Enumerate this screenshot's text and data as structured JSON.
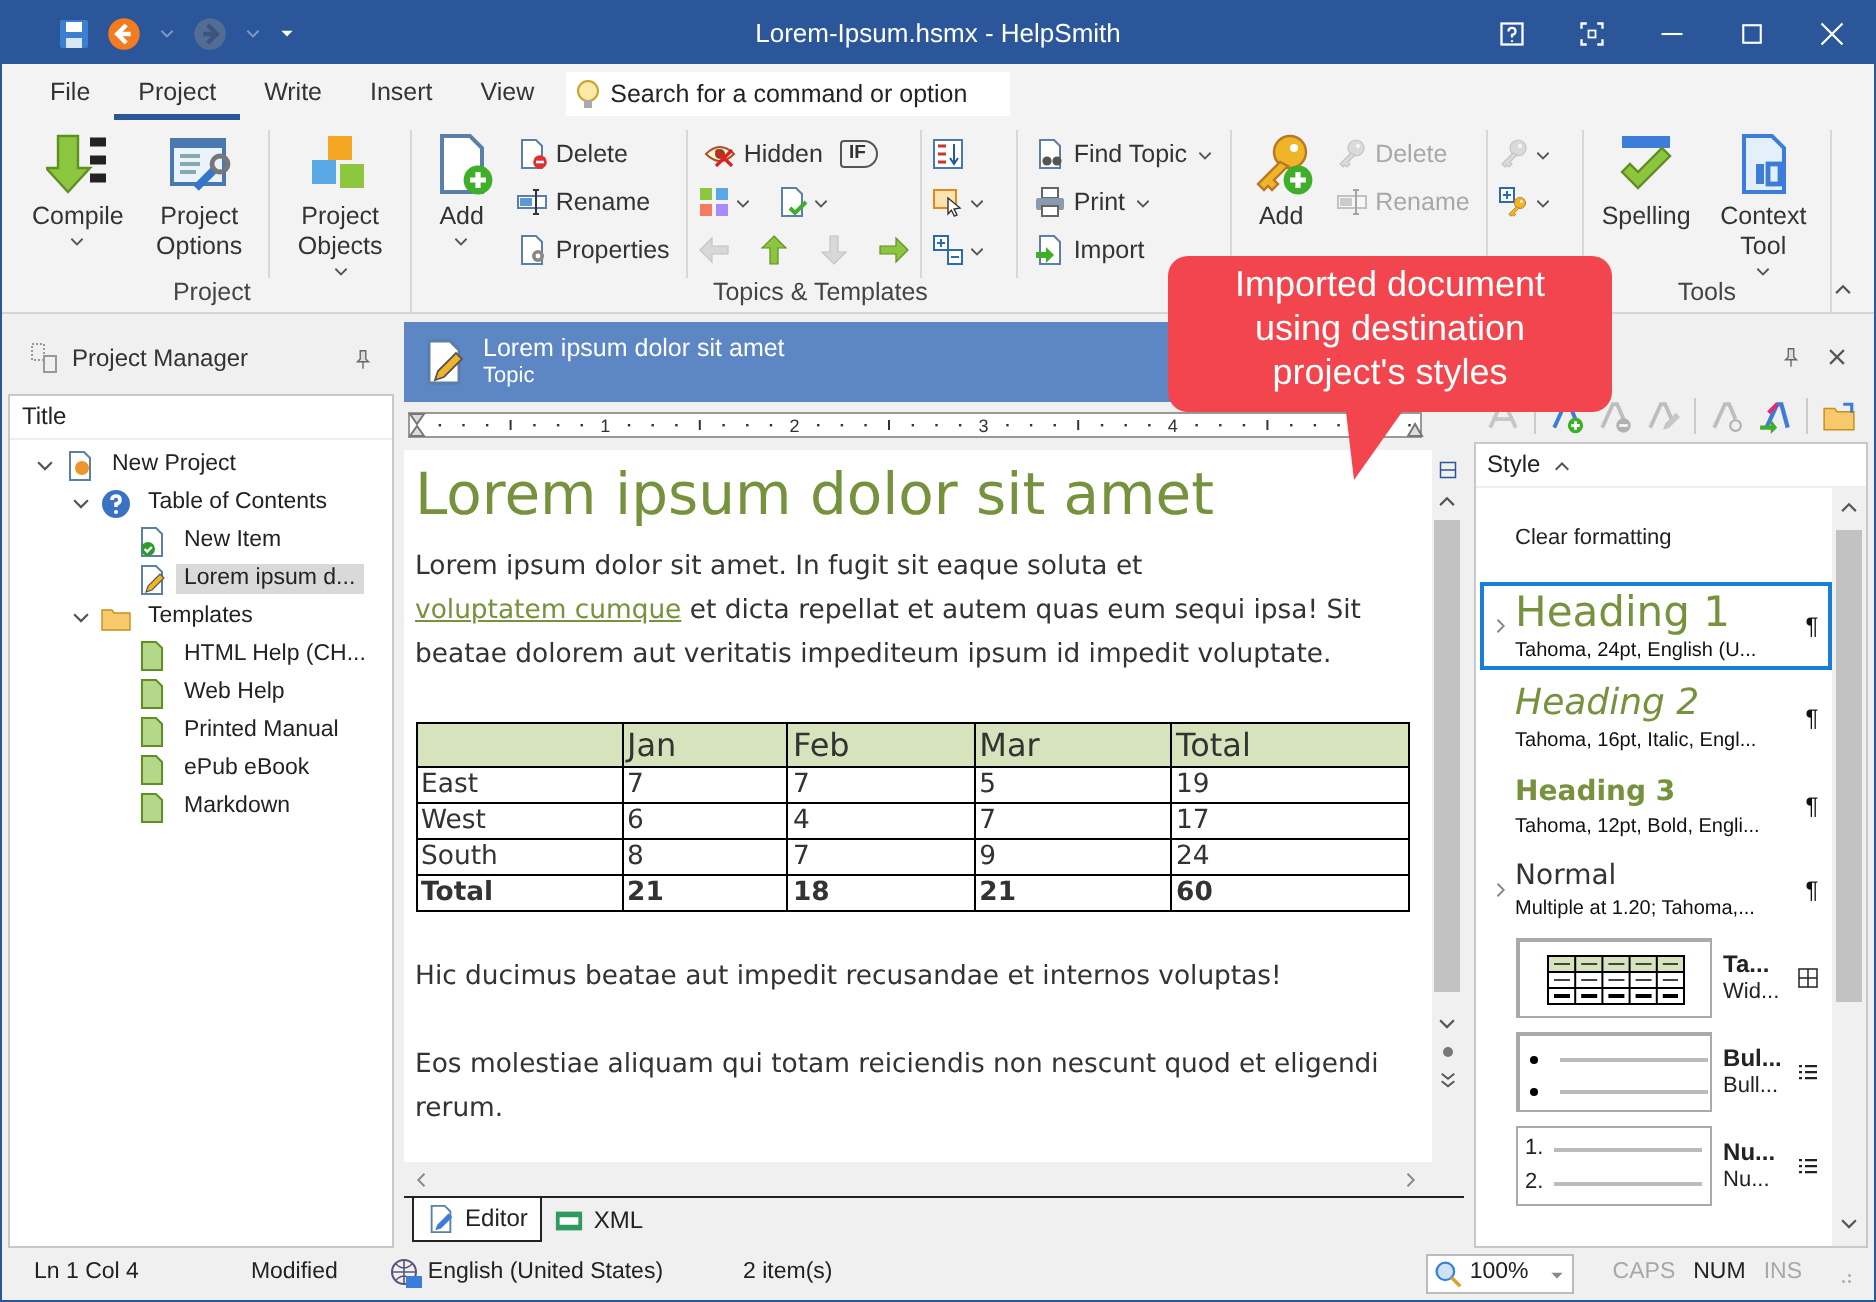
{
  "window": {
    "title": "Lorem-Ipsum.hsmx - HelpSmith"
  },
  "quick_access": [
    {
      "disabled": false
    },
    {
      "disabled": true
    }
  ],
  "ribbon_tabs": [
    {
      "label": "File",
      "selected": false
    },
    {
      "label": "Project",
      "selected": true
    },
    {
      "label": "Write",
      "selected": false
    },
    {
      "label": "Insert",
      "selected": false
    },
    {
      "label": "View",
      "selected": false
    }
  ],
  "command_search": {
    "placeholder": "Search for a command or option"
  },
  "ribbon_groups": [
    {
      "label": "Project",
      "columns": [
        {
          "divider_before": false,
          "rows": [
            [
              {
                "kind": "large",
                "label": "Compile",
                "dropdown": true,
                "disabled": false
              }
            ]
          ]
        },
        {
          "divider_before": false,
          "rows": [
            [
              {
                "kind": "large",
                "label": "Project Options",
                "dropdown": false,
                "disabled": false
              }
            ]
          ]
        },
        {
          "divider_before": true,
          "rows": [
            [
              {
                "kind": "large",
                "label": "Project Objects",
                "dropdown": true,
                "disabled": false
              }
            ]
          ]
        }
      ]
    },
    {
      "label": "Topics & Templates",
      "columns": [
        {
          "divider_before": false,
          "rows": [
            [
              {
                "kind": "large",
                "label": "Add",
                "dropdown": true,
                "disabled": false
              }
            ]
          ]
        },
        {
          "divider_before": false,
          "rows": [
            [
              {
                "kind": "small",
                "label": "Delete",
                "dropdown": false,
                "disabled": false
              }
            ],
            [
              {
                "kind": "small",
                "label": "Rename",
                "dropdown": false,
                "disabled": false
              }
            ],
            [
              {
                "kind": "small",
                "label": "Properties",
                "dropdown": false,
                "disabled": false
              }
            ]
          ]
        },
        {
          "divider_before": true,
          "rows": [
            [
              {
                "kind": "small",
                "label": "Hidden",
                "dropdown": false,
                "disabled": false
              },
              {
                "kind": "tag",
                "label": "IF"
              }
            ],
            [
              {
                "kind": "icon",
                "dropdown": true,
                "disabled": false
              },
              {
                "kind": "icon",
                "dropdown": true,
                "disabled": false
              }
            ],
            [
              {
                "kind": "icon",
                "dropdown": false,
                "disabled": true
              },
              {
                "kind": "icon",
                "dropdown": false,
                "disabled": false
              },
              {
                "kind": "icon",
                "dropdown": false,
                "disabled": true
              },
              {
                "kind": "icon",
                "dropdown": false,
                "disabled": false
              }
            ]
          ]
        },
        {
          "divider_before": true,
          "rows": [
            [
              {
                "kind": "icon",
                "dropdown": false,
                "disabled": false
              }
            ],
            [
              {
                "kind": "icon",
                "dropdown": true,
                "disabled": false
              }
            ],
            [
              {
                "kind": "icon",
                "dropdown": true,
                "disabled": false
              }
            ]
          ]
        },
        {
          "divider_before": true,
          "rows": [
            [
              {
                "kind": "small",
                "label": "Find Topic",
                "dropdown": true,
                "disabled": false
              }
            ],
            [
              {
                "kind": "small",
                "label": "Print",
                "dropdown": true,
                "disabled": false
              }
            ],
            [
              {
                "kind": "small",
                "label": "Import",
                "dropdown": false,
                "disabled": false
              }
            ]
          ]
        }
      ]
    },
    {
      "columns": [
        {
          "divider_before": false,
          "rows": [
            [
              {
                "kind": "large",
                "label": "Add",
                "dropdown": false,
                "disabled": false
              }
            ]
          ]
        },
        {
          "divider_before": false,
          "rows": [
            [
              {
                "kind": "small",
                "label": "Delete",
                "dropdown": false,
                "disabled": true
              }
            ],
            [
              {
                "kind": "small",
                "label": "Rename",
                "dropdown": false,
                "disabled": true
              }
            ]
          ]
        },
        {
          "divider_before": true,
          "rows": [
            [
              {
                "kind": "icon",
                "dropdown": true,
                "disabled": true
              }
            ],
            [
              {
                "kind": "icon",
                "dropdown": true,
                "disabled": false
              }
            ]
          ]
        }
      ]
    },
    {
      "label": "Tools",
      "columns": [
        {
          "divider_before": false,
          "rows": [
            [
              {
                "kind": "large",
                "label": "Spelling",
                "dropdown": false,
                "disabled": false
              }
            ]
          ]
        },
        {
          "divider_before": false,
          "rows": [
            [
              {
                "kind": "large",
                "label": "Context Tool",
                "dropdown": true,
                "disabled": false
              }
            ]
          ]
        }
      ]
    }
  ],
  "callout": {
    "text": "Imported document\nusing destination\nproject's styles"
  },
  "project_manager": {
    "title": "Project Manager",
    "column": "Title",
    "tree": [
      {
        "label": "New Project",
        "kind": "project",
        "selected": false,
        "expanded": true,
        "children": [
          {
            "label": "Table of Contents",
            "kind": "contents",
            "selected": false,
            "expanded": true,
            "children": [
              {
                "label": "New Item",
                "kind": "finished",
                "selected": false
              },
              {
                "label": "Lorem ipsum d...",
                "kind": "draft",
                "selected": true
              }
            ]
          },
          {
            "label": "Templates",
            "kind": "folder",
            "selected": false,
            "expanded": true,
            "children": [
              {
                "label": "HTML Help (CH...",
                "kind": "template",
                "selected": false
              },
              {
                "label": "Web Help",
                "kind": "template",
                "selected": false
              },
              {
                "label": "Printed Manual",
                "kind": "template",
                "selected": false
              },
              {
                "label": "ePub eBook",
                "kind": "template",
                "selected": false
              },
              {
                "label": "Markdown",
                "kind": "template",
                "selected": false
              }
            ]
          }
        ]
      }
    ]
  },
  "document": {
    "title": "Lorem ipsum dolor sit amet",
    "subtitle": "Topic",
    "ruler": [
      "1",
      "2",
      "3",
      "4"
    ],
    "body": [
      {
        "kind": "heading",
        "text": "Lorem ipsum dolor sit amet"
      },
      {
        "kind": "paragraph",
        "parts": [
          {
            "text": "Lorem ipsum dolor sit amet. In fugit sit eaque soluta et ",
            "link": false
          },
          {
            "text": "voluptatem cumque",
            "link": true
          },
          {
            "text": " et dicta repellat et autem quas eum sequi ipsa! Sit beatae dolorem aut veritatis impediteum ipsum id impedit voluptate.",
            "link": false
          }
        ]
      },
      {
        "kind": "table",
        "columns": [
          "Jan",
          "Feb",
          "Mar",
          "Total"
        ],
        "rows": [
          {
            "label": "East",
            "cells": [
              "7",
              "7",
              "5",
              "19"
            ],
            "total": false
          },
          {
            "label": "West",
            "cells": [
              "6",
              "4",
              "7",
              "17"
            ],
            "total": false
          },
          {
            "label": "South",
            "cells": [
              "8",
              "7",
              "9",
              "24"
            ],
            "total": false
          },
          {
            "label": "Total",
            "cells": [
              "21",
              "18",
              "21",
              "60"
            ],
            "total": true
          }
        ]
      },
      {
        "kind": "paragraph",
        "parts": [
          {
            "text": "Hic ducimus beatae aut impedit recusandae et internos voluptas!",
            "link": false
          }
        ]
      },
      {
        "kind": "paragraph",
        "parts": [
          {
            "text": "Eos molestiae aliquam qui totam reiciendis non nescunt quod et eligendi rerum.",
            "link": false
          }
        ]
      }
    ],
    "tabs": [
      {
        "label": "Editor",
        "selected": true
      },
      {
        "label": "XML",
        "selected": false
      }
    ]
  },
  "styles_panel": {
    "toolbar": [
      {
        "disabled": true
      },
      {
        "disabled": false
      },
      {
        "disabled": true
      },
      {
        "disabled": true
      },
      {
        "disabled": true
      },
      {
        "disabled": false
      },
      {
        "disabled": false
      }
    ],
    "column": "Style",
    "styles": [
      {
        "kind": "clear",
        "name": "Clear formatting",
        "selected": false,
        "expandable": false
      },
      {
        "kind": "heading1",
        "name": "Heading 1",
        "description": "Tahoma, 24pt, English (U...",
        "mark": "¶",
        "selected": true,
        "expandable": true
      },
      {
        "kind": "heading2",
        "name": "Heading 2",
        "description": "Tahoma, 16pt, Italic, Engl...",
        "mark": "¶",
        "selected": false,
        "expandable": false
      },
      {
        "kind": "heading3",
        "name": "Heading 3",
        "description": "Tahoma, 12pt, Bold, Engli...",
        "mark": "¶",
        "selected": false,
        "expandable": false
      },
      {
        "kind": "normal",
        "name": "Normal",
        "description": "Multiple at 1.20; Tahoma,...",
        "mark": "¶",
        "selected": false,
        "expandable": true
      },
      {
        "kind": "table",
        "name": "Ta...",
        "description": "Wid...",
        "selected": false,
        "expandable": false
      },
      {
        "kind": "bullets",
        "name": "Bul...",
        "description": "Bull...",
        "selected": false,
        "expandable": false
      },
      {
        "kind": "numbering",
        "name": "Nu...",
        "description": "Nu...",
        "preview": [
          "1.",
          "2."
        ],
        "selected": false,
        "expandable": false
      }
    ]
  },
  "status_bar": {
    "position": "Ln 1 Col 4",
    "state": "Modified",
    "language": "English (United States)",
    "selection": "2 item(s)",
    "zoom": "100%",
    "indicators": [
      {
        "label": "CAPS",
        "on": false
      },
      {
        "label": "NUM",
        "on": true
      },
      {
        "label": "INS",
        "on": false
      }
    ]
  }
}
